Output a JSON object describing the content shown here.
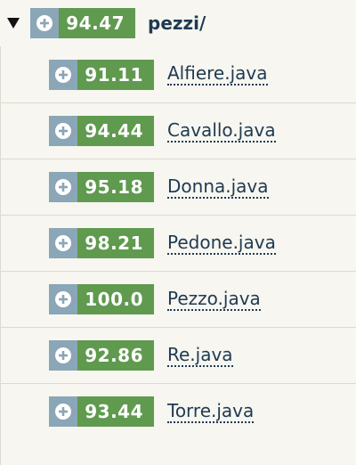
{
  "root": {
    "caret_icon": "caret-down-icon",
    "expand_icon": "plus-circle-icon",
    "score": "94.47",
    "label": "pezzi/"
  },
  "files": [
    {
      "score": "91.11",
      "name": "Alfiere.java"
    },
    {
      "score": "94.44",
      "name": "Cavallo.java"
    },
    {
      "score": "95.18",
      "name": "Donna.java"
    },
    {
      "score": "98.21",
      "name": "Pedone.java"
    },
    {
      "score": "100.0",
      "name": "Pezzo.java"
    },
    {
      "score": "92.86",
      "name": "Re.java"
    },
    {
      "score": "93.44",
      "name": "Torre.java"
    }
  ],
  "colors": {
    "background": "#f7f6f0",
    "plus_bg": "#8aa6b7",
    "score_bg": "#5f9a4f",
    "text": "#1f3a52",
    "divider": "#ddd9cf"
  }
}
